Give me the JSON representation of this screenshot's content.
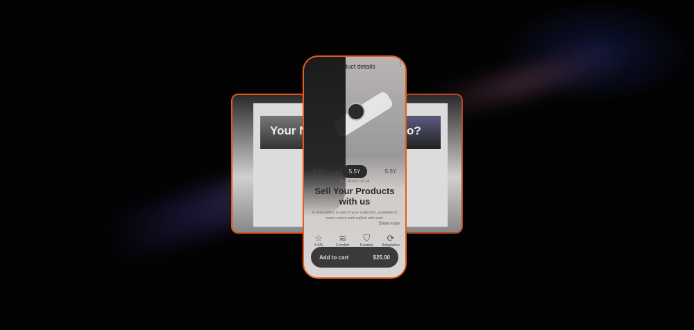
{
  "back_cards": {
    "left_title": "Your N",
    "right_title": "o?"
  },
  "phone": {
    "header_title": "Product details",
    "sizes": [
      "5.5Y",
      "5.5Y",
      "5.5Y"
    ],
    "selected_size_index": 1,
    "subtitle": "Big shoes for all",
    "title_line1": "Sell Your Products",
    "title_line2": "with us",
    "description": "A new edition to add in your collection, available in many colors and crafted with care",
    "show_more": "Show more",
    "features": [
      {
        "icon": "star-icon",
        "label": "4.6/5"
      },
      {
        "icon": "layers-icon",
        "label": "Comfort"
      },
      {
        "icon": "shield-check-icon",
        "label": "Durable"
      },
      {
        "icon": "refresh-icon",
        "label": "Adaptative"
      }
    ],
    "cart_label": "Add to cart",
    "price": "$25.00"
  }
}
